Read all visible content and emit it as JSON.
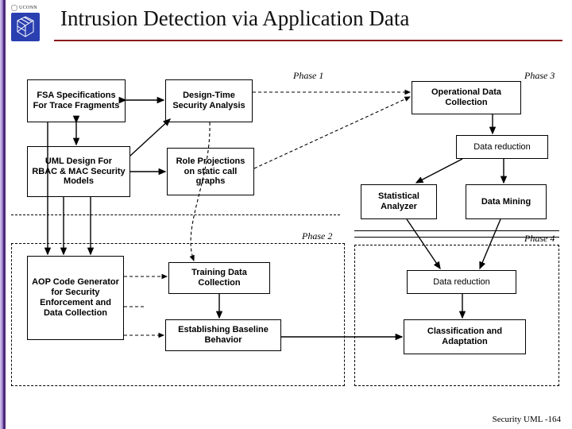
{
  "header": {
    "org": "UCONN",
    "title": "Intrusion Detection via Application Data"
  },
  "phases": {
    "p1": "Phase 1",
    "p2": "Phase 2",
    "p3": "Phase 3",
    "p4": "Phase 4"
  },
  "boxes": {
    "fsa": "FSA Specifications For Trace Fragments",
    "dts": "Design-Time Security Analysis",
    "uml": "UML Design For RBAC & MAC Security Models",
    "role": "Role Projections on static call graphs",
    "aop": "AOP Code Generator for Security Enforcement and Data Collection",
    "train": "Training Data Collection",
    "baseline": "Establishing Baseline Behavior",
    "odc": "Operational Data Collection",
    "dr1": "Data reduction",
    "stat": "Statistical Analyzer",
    "mining": "Data Mining",
    "dr2": "Data reduction",
    "classif": "Classification and Adaptation"
  },
  "footer": "Security UML -164",
  "colors": {
    "rule": "#8b1a1a",
    "logo_bg": "#2a3fb0"
  }
}
